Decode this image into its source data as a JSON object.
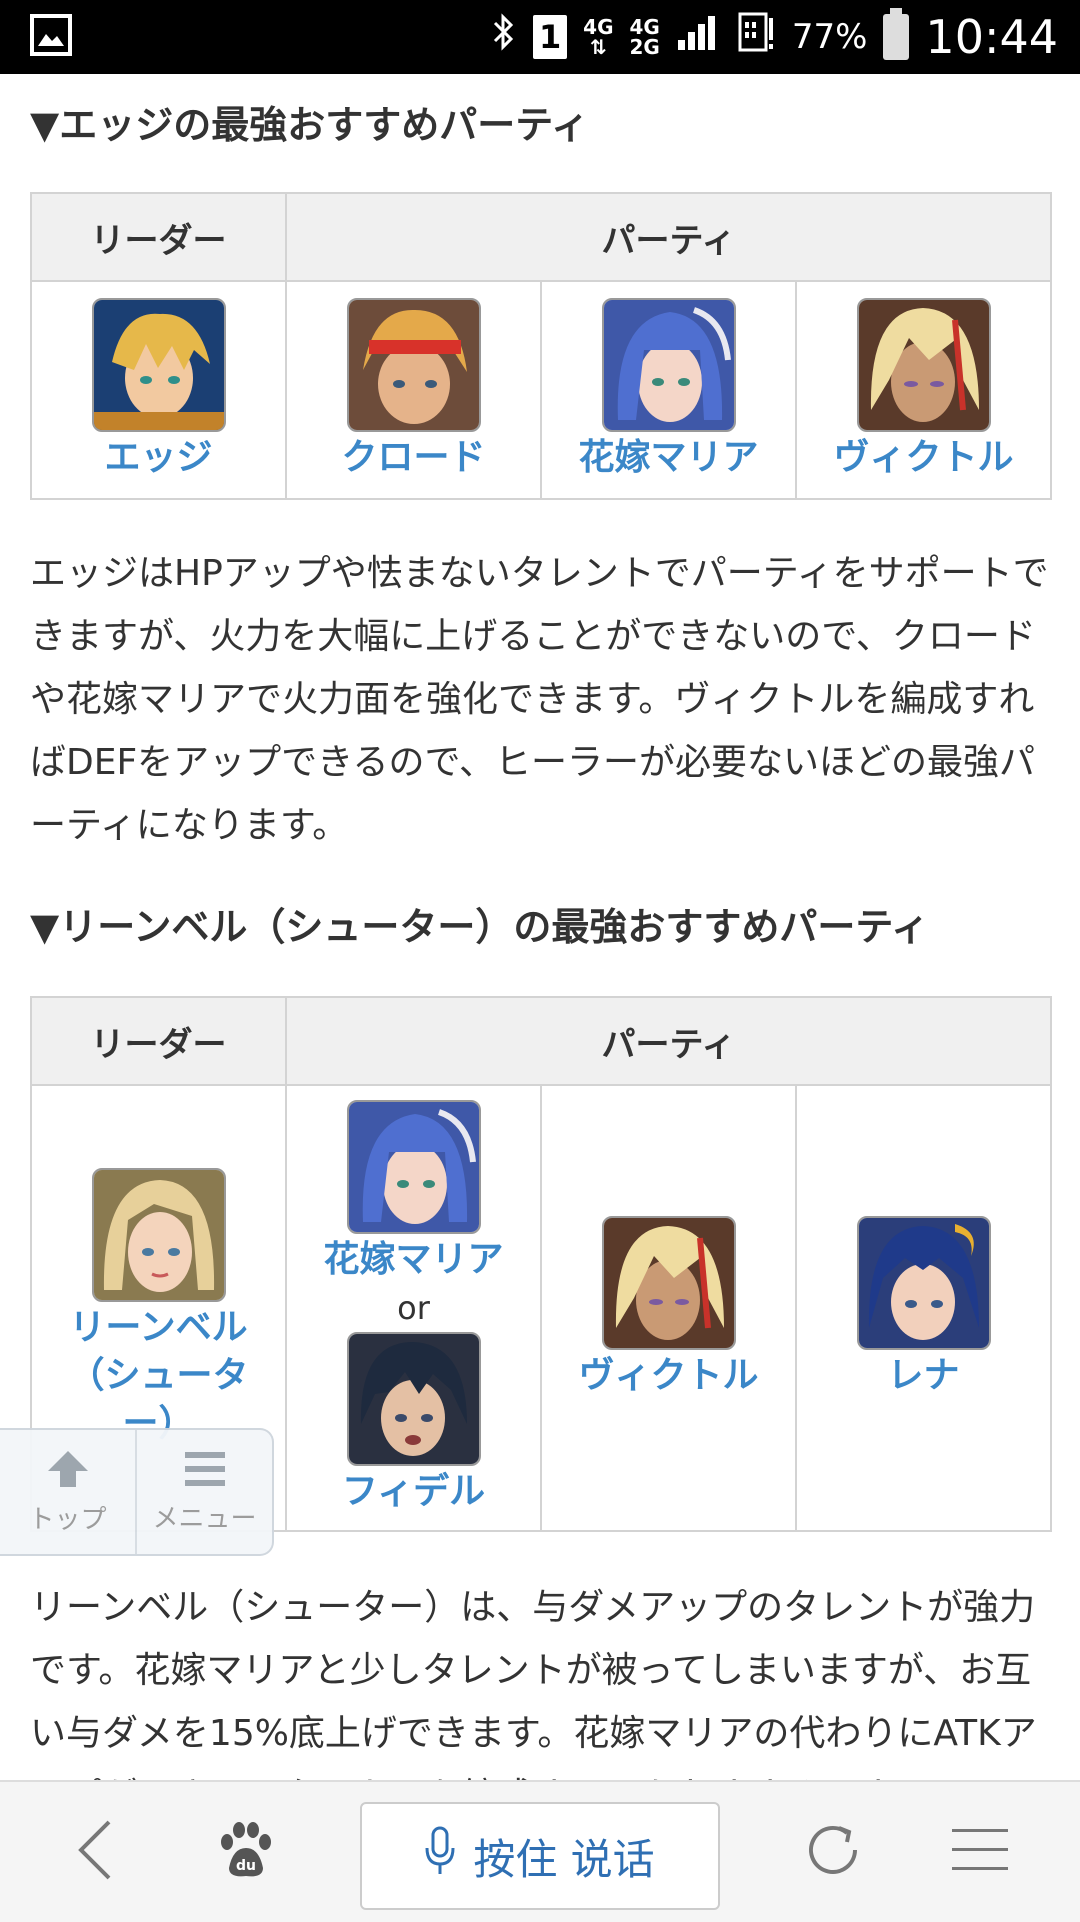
{
  "status_bar": {
    "network_top": "4G",
    "network_mid": "4G",
    "network_mid2": "2G",
    "sim": "1",
    "battery": "77%",
    "time": "10:44"
  },
  "section1": {
    "heading": "▼エッジの最強おすすめパーティ",
    "col_leader": "リーダー",
    "col_party": "パーティ",
    "leader": "エッジ",
    "party": [
      "クロード",
      "花嫁マリア",
      "ヴィクトル"
    ],
    "paragraph": "エッジはHPアップや怯まないタレントでパーティをサポートできますが、火力を大幅に上げることができないので、クロードや花嫁マリアで火力面を強化できます。ヴィクトルを編成すればDEFをアップできるので、ヒーラーが必要ないほどの最強パーティになります。"
  },
  "section2": {
    "heading": "▼リーンベル（シューター）の最強おすすめパーティ",
    "col_leader": "リーダー",
    "col_party": "パーティ",
    "leader": "リーンベル（シューター）",
    "party_alt_a": "花嫁マリア",
    "party_or": "or",
    "party_alt_b": "フィデル",
    "party2": "ヴィクトル",
    "party3": "レナ",
    "paragraph": "リーンベル（シューター）は、与ダメアップのタレントが強力です。花嫁マリアと少しタレントが被ってしまいますが、お互い与ダメを15%底上げできます。花嫁マリアの代わりにATKアップができるスターカーを編成するのもおすすめです。"
  },
  "floating_nav": {
    "top_label": "トップ",
    "menu_label": "メニュー"
  },
  "bottom_bar": {
    "voice_label": "按住 说话"
  },
  "colors": {
    "link": "#3b87c8",
    "header_bg": "#f0f0f0",
    "voice_text": "#2f6fb3"
  },
  "icons": [
    "image-icon",
    "bluetooth-icon",
    "signal-icon",
    "battery-icon",
    "arrow-up-icon",
    "menu-icon",
    "back-icon",
    "paw-icon",
    "microphone-icon",
    "refresh-icon",
    "hamburger-icon"
  ]
}
